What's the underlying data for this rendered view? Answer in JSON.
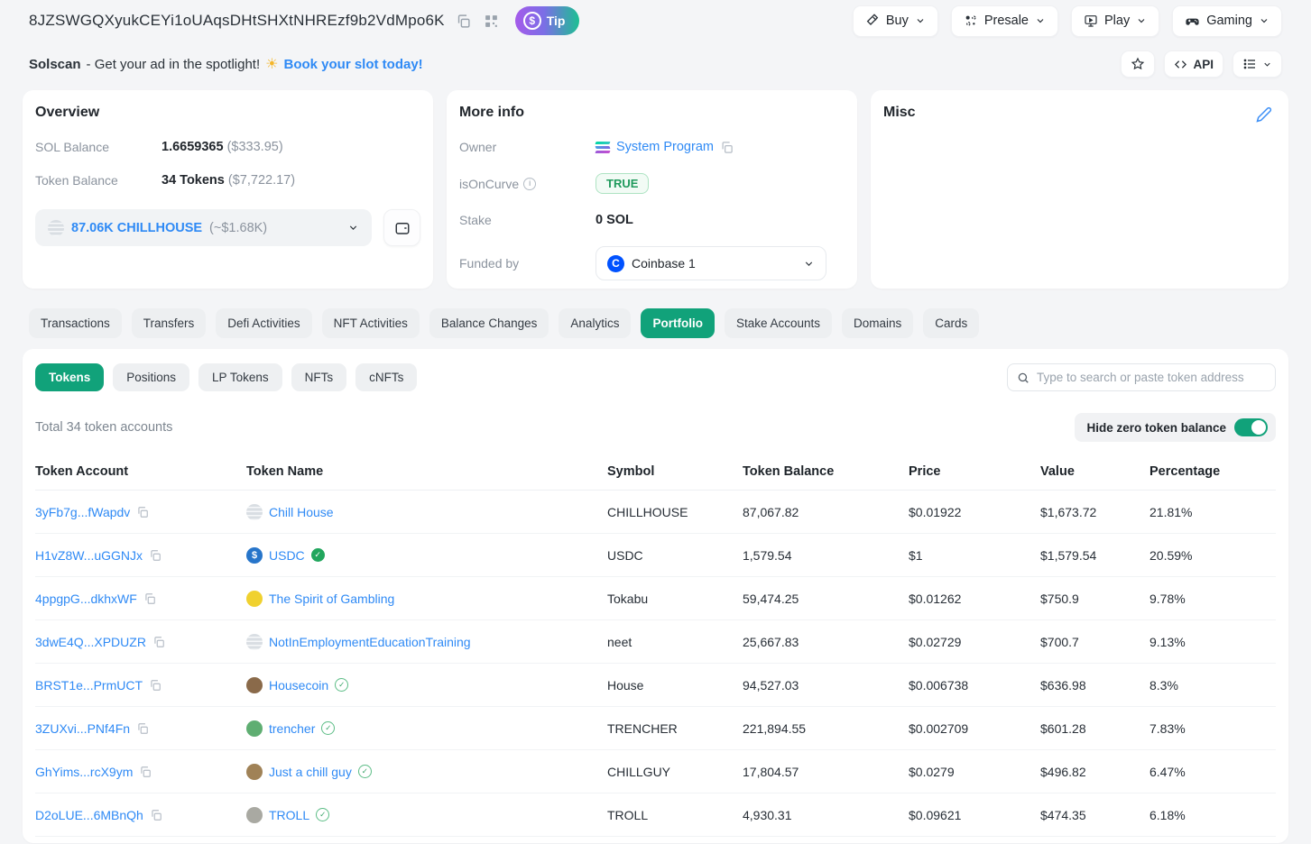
{
  "colors": {
    "accent_green": "#11a27a",
    "link_blue": "#2f8af5",
    "tip_gradient_start": "#a55bea",
    "tip_gradient_end": "#1cbf92"
  },
  "header": {
    "address": "8JZSWGQXyukCEYi1oUAqsDHtSHXtNHREzf9b2VdMpo6K",
    "tip_label": "Tip",
    "nav_buttons": [
      {
        "label": "Buy",
        "icon": "buy-icon"
      },
      {
        "label": "Presale",
        "icon": "presale-icon"
      },
      {
        "label": "Play",
        "icon": "play-icon"
      },
      {
        "label": "Gaming",
        "icon": "gaming-icon"
      }
    ]
  },
  "banner": {
    "brand": "Solscan",
    "text": "- Get your ad in the spotlight!",
    "sun": "☀",
    "link_label": "Book your slot today!",
    "api_label": "API"
  },
  "overview": {
    "title": "Overview",
    "sol_balance_label": "SOL Balance",
    "sol_balance": "1.6659365",
    "sol_balance_usd": "($333.95)",
    "token_balance_label": "Token Balance",
    "token_balance": "34 Tokens",
    "token_balance_usd": "($7,722.17)",
    "token_selector_amount": "87.06K CHILLHOUSE",
    "token_selector_usd": "(~$1.68K)"
  },
  "more_info": {
    "title": "More info",
    "owner_label": "Owner",
    "owner_value": "System Program",
    "isoncurve_label": "isOnCurve",
    "isoncurve_info": "i",
    "isoncurve_value": "TRUE",
    "stake_label": "Stake",
    "stake_value": "0 SOL",
    "funded_by_label": "Funded by",
    "funded_by_value": "Coinbase 1"
  },
  "misc": {
    "title": "Misc"
  },
  "tabs": [
    {
      "label": "Transactions",
      "active": false
    },
    {
      "label": "Transfers",
      "active": false
    },
    {
      "label": "Defi Activities",
      "active": false
    },
    {
      "label": "NFT Activities",
      "active": false
    },
    {
      "label": "Balance Changes",
      "active": false
    },
    {
      "label": "Analytics",
      "active": false
    },
    {
      "label": "Portfolio",
      "active": true
    },
    {
      "label": "Stake Accounts",
      "active": false
    },
    {
      "label": "Domains",
      "active": false
    },
    {
      "label": "Cards",
      "active": false
    }
  ],
  "portfolio": {
    "subtabs": [
      {
        "label": "Tokens",
        "active": true
      },
      {
        "label": "Positions",
        "active": false
      },
      {
        "label": "LP Tokens",
        "active": false
      },
      {
        "label": "NFTs",
        "active": false
      },
      {
        "label": "cNFTs",
        "active": false
      }
    ],
    "search_placeholder": "Type to search or paste token address",
    "total_text": "Total 34 token accounts",
    "hide_zero_label": "Hide zero token balance",
    "table": {
      "columns": [
        "Token Account",
        "Token Name",
        "Symbol",
        "Token Balance",
        "Price",
        "Value",
        "Percentage"
      ],
      "rows": [
        {
          "account": "3yFb7g...fWapdv",
          "name": "Chill House",
          "symbol": "CHILLHOUSE",
          "balance": "87,067.82",
          "price": "$0.01922",
          "value": "$1,673.72",
          "percentage": "21.81%",
          "icon": "generic",
          "icon_color": "",
          "icon_glyph": "",
          "verified": "none"
        },
        {
          "account": "H1vZ8W...uGGNJx",
          "name": "USDC",
          "symbol": "USDC",
          "balance": "1,579.54",
          "price": "$1",
          "value": "$1,579.54",
          "percentage": "20.59%",
          "icon": "solid",
          "icon_color": "#2775ca",
          "icon_glyph": "$",
          "verified": "filled"
        },
        {
          "account": "4ppgpG...dkhxWF",
          "name": "The Spirit of Gambling",
          "symbol": "Tokabu",
          "balance": "59,474.25",
          "price": "$0.01262",
          "value": "$750.9",
          "percentage": "9.78%",
          "icon": "solid",
          "icon_color": "#f0d12f",
          "icon_glyph": "",
          "verified": "none"
        },
        {
          "account": "3dwE4Q...XPDUZR",
          "name": "NotInEmploymentEducationTraining",
          "symbol": "neet",
          "balance": "25,667.83",
          "price": "$0.02729",
          "value": "$700.7",
          "percentage": "9.13%",
          "icon": "generic",
          "icon_color": "",
          "icon_glyph": "",
          "verified": "none"
        },
        {
          "account": "BRST1e...PrmUCT",
          "name": "Housecoin",
          "symbol": "House",
          "balance": "94,527.03",
          "price": "$0.006738",
          "value": "$636.98",
          "percentage": "8.3%",
          "icon": "solid",
          "icon_color": "#8a6a4a",
          "icon_glyph": "",
          "verified": "outline"
        },
        {
          "account": "3ZUXvi...PNf4Fn",
          "name": "trencher",
          "symbol": "TRENCHER",
          "balance": "221,894.55",
          "price": "$0.002709",
          "value": "$601.28",
          "percentage": "7.83%",
          "icon": "solid",
          "icon_color": "#5fae72",
          "icon_glyph": "",
          "verified": "outline"
        },
        {
          "account": "GhYims...rcX9ym",
          "name": "Just a chill guy",
          "symbol": "CHILLGUY",
          "balance": "17,804.57",
          "price": "$0.0279",
          "value": "$496.82",
          "percentage": "6.47%",
          "icon": "solid",
          "icon_color": "#a08257",
          "icon_glyph": "",
          "verified": "outline"
        },
        {
          "account": "D2oLUE...6MBnQh",
          "name": "TROLL",
          "symbol": "TROLL",
          "balance": "4,930.31",
          "price": "$0.09621",
          "value": "$474.35",
          "percentage": "6.18%",
          "icon": "solid",
          "icon_color": "#a9a9a2",
          "icon_glyph": "",
          "verified": "outline"
        }
      ]
    }
  }
}
